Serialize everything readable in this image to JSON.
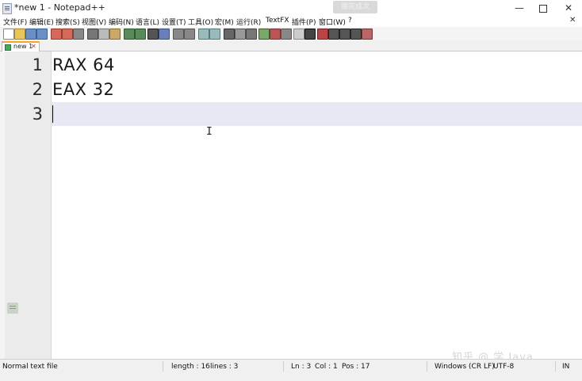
{
  "window": {
    "title": "*new 1 - Notepad++",
    "badge": "赠完成次",
    "controls": {
      "minimize": "—",
      "close": "✕"
    }
  },
  "menu": [
    "文件(F)",
    "编辑(E)",
    "搜索(S)",
    "视图(V)",
    "编码(N)",
    "语言(L)",
    "设置(T)",
    "工具(O)",
    "宏(M)",
    "运行(R)",
    "TextFX",
    "插件(P)",
    "窗口(W)",
    "?"
  ],
  "menu_close": "✕",
  "tab": {
    "label": "new 1",
    "close": "✕"
  },
  "editor": {
    "line_numbers": [
      "1",
      "2",
      "3"
    ],
    "lines": [
      "RAX 64",
      "EAX 32",
      ""
    ],
    "ibeam": "I"
  },
  "watermark": "知乎 @ 学 Java",
  "status": {
    "file_type": "Normal text file",
    "length": "length : 16",
    "lines": "lines : 3",
    "ln": "Ln : 3",
    "col": "Col : 1",
    "pos": "Pos : 17",
    "eol": "Windows (CR LF)",
    "encoding": "UTF-8",
    "mode": "IN"
  },
  "colors": {
    "current_line": "#e8e8f4",
    "gutter": "#ebebeb",
    "tab_accent": "#f5a623"
  }
}
